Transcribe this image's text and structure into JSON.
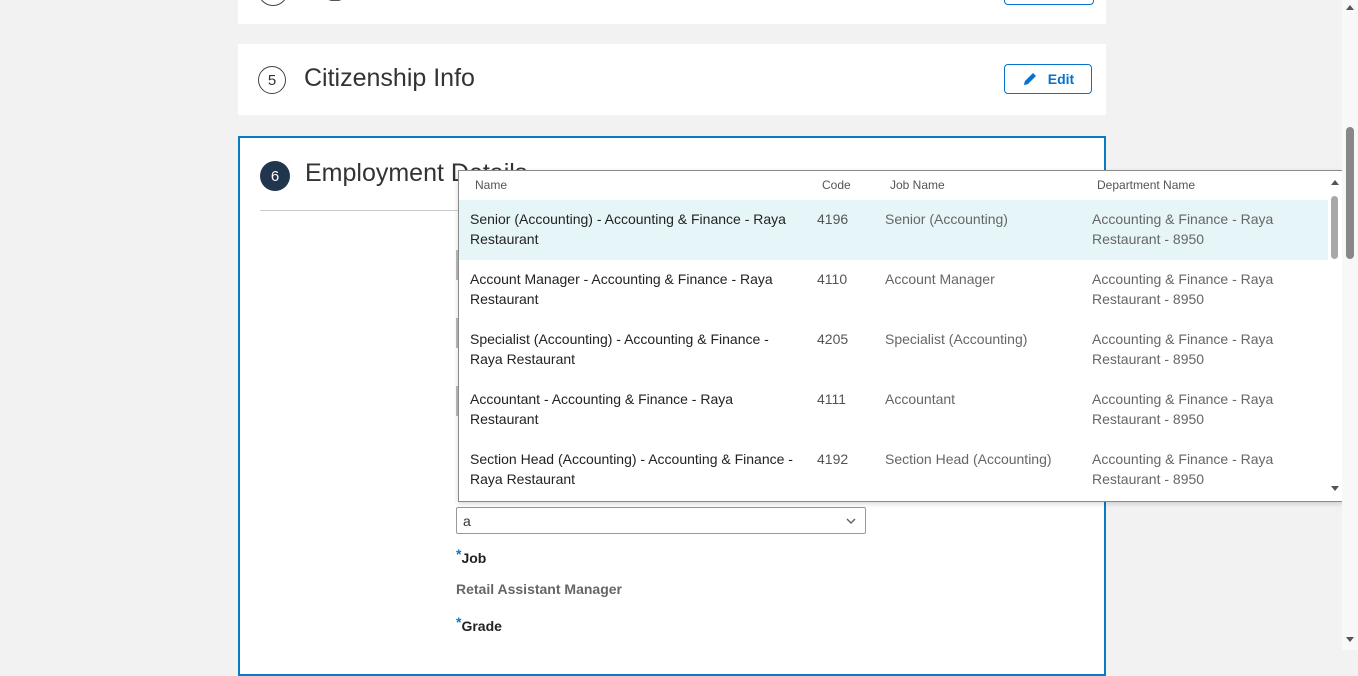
{
  "sections": {
    "citizenship": {
      "step": "5",
      "title": "Citizenship Info",
      "edit_label": "Edit"
    },
    "employment": {
      "step": "6",
      "title": "Employment Details"
    }
  },
  "form": {
    "search_value": "a",
    "job_label": "Job",
    "job_value": "Retail Assistant Manager",
    "grade_label": "Grade",
    "required_marker": "*"
  },
  "dropdown": {
    "columns": [
      "Name",
      "Code",
      "Job Name",
      "Department Name"
    ],
    "rows": [
      {
        "name": "Senior (Accounting) - Accounting & Finance - Raya Restaurant",
        "code": "4196",
        "job": "Senior (Accounting)",
        "department": "Accounting & Finance - Raya Restaurant - 8950"
      },
      {
        "name": "Account Manager - Accounting & Finance - Raya Restaurant",
        "code": "4110",
        "job": "Account Manager",
        "department": "Accounting & Finance - Raya Restaurant - 8950"
      },
      {
        "name": "Specialist (Accounting) - Accounting & Finance - Raya Restaurant",
        "code": "4205",
        "job": "Specialist (Accounting)",
        "department": "Accounting & Finance - Raya Restaurant - 8950"
      },
      {
        "name": "Accountant - Accounting & Finance - Raya Restaurant",
        "code": "4111",
        "job": "Accountant",
        "department": "Accounting & Finance - Raya Restaurant - 8950"
      },
      {
        "name": "Section Head (Accounting) - Accounting & Finance - Raya Restaurant",
        "code": "4192",
        "job": "Section Head (Accounting)",
        "department": "Accounting & Finance - Raya Restaurant - 8950"
      }
    ]
  },
  "icons": {
    "edit": "pencil-icon",
    "select": "chevron-down-icon"
  },
  "colors": {
    "accent": "#0572ce",
    "active_border": "#0a7ac2",
    "step_fill": "#22354e",
    "selected_row": "#e6f5f8"
  }
}
